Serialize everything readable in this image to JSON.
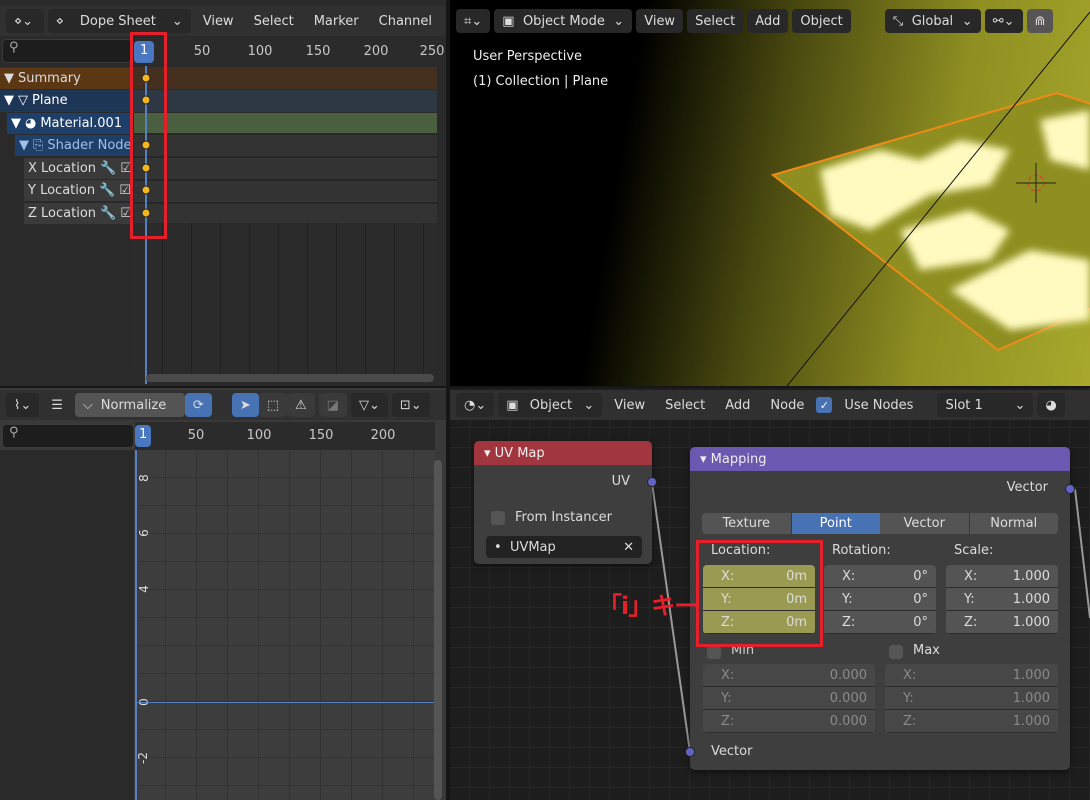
{
  "dope_sheet": {
    "editor_type_icon": "dope-sheet-icon",
    "mode": "Dope Sheet",
    "menus": [
      "View",
      "Select",
      "Marker",
      "Channel"
    ],
    "current_frame": "1",
    "frame_ticks": [
      "50",
      "100",
      "150",
      "200",
      "250"
    ],
    "channels": [
      {
        "label": "Summary",
        "icon": "triangle-down"
      },
      {
        "label": "Plane",
        "icon": "mesh-icon"
      },
      {
        "label": "Material.001",
        "icon": "material-icon"
      },
      {
        "label": "Shader Nodetree",
        "icon": "node-tree-icon"
      },
      {
        "label": "X Location"
      },
      {
        "label": "Y Location"
      },
      {
        "label": "Z Location"
      }
    ],
    "colors": {
      "summary": "#4a3222",
      "object": "#2c3a4e",
      "material": "#4a6040",
      "keyframe": "#f5b51f"
    }
  },
  "viewport": {
    "mode": "Object Mode",
    "menus": [
      "View",
      "Select",
      "Add",
      "Object"
    ],
    "transform_orientation": "Global",
    "overlay_line1": "User Perspective",
    "overlay_line2": "(1) Collection | Plane"
  },
  "graph_editor": {
    "normalize_label": "Normalize",
    "current_frame": "1",
    "frame_ticks": [
      "50",
      "100",
      "150",
      "200"
    ],
    "value_ticks": [
      "8",
      "6",
      "4",
      "0",
      "-2"
    ]
  },
  "node_editor": {
    "object_type": "Object",
    "menus": [
      "View",
      "Select",
      "Add",
      "Node"
    ],
    "use_nodes_label": "Use Nodes",
    "use_nodes": true,
    "slot": "Slot 1",
    "uv_map_node": {
      "title": "UV Map",
      "output": "UV",
      "from_instancer": "From Instancer",
      "uv_map": "UVMap",
      "color": "#a2363f"
    },
    "mapping_node": {
      "title": "Mapping",
      "output": "Vector",
      "input": "Vector",
      "color": "#6b58b0",
      "types": [
        "Texture",
        "Point",
        "Vector",
        "Normal"
      ],
      "active_type": "Point",
      "location_label": "Location:",
      "rotation_label": "Rotation:",
      "scale_label": "Scale:",
      "location": [
        {
          "axis": "X:",
          "value": "0m"
        },
        {
          "axis": "Y:",
          "value": "0m"
        },
        {
          "axis": "Z:",
          "value": "0m"
        }
      ],
      "rotation": [
        {
          "axis": "X:",
          "value": "0°"
        },
        {
          "axis": "Y:",
          "value": "0°"
        },
        {
          "axis": "Z:",
          "value": "0°"
        }
      ],
      "scale": [
        {
          "axis": "X:",
          "value": "1.000"
        },
        {
          "axis": "Y:",
          "value": "1.000"
        },
        {
          "axis": "Z:",
          "value": "1.000"
        }
      ],
      "min_label": "Min",
      "max_label": "Max",
      "min": [
        {
          "axis": "X:",
          "value": "0.000"
        },
        {
          "axis": "Y:",
          "value": "0.000"
        },
        {
          "axis": "Z:",
          "value": "0.000"
        }
      ],
      "max": [
        {
          "axis": "X:",
          "value": "1.000"
        },
        {
          "axis": "Y:",
          "value": "1.000"
        },
        {
          "axis": "Z:",
          "value": "1.000"
        }
      ]
    }
  },
  "annotation": {
    "label": "「i」キー",
    "color": "#e5202a"
  }
}
